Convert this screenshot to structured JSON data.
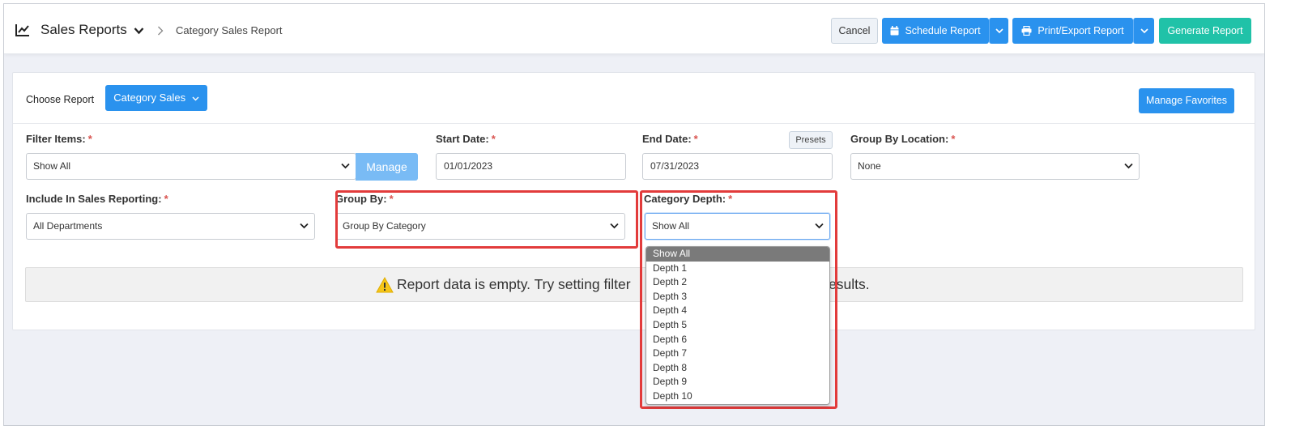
{
  "header": {
    "app_title": "Sales Reports",
    "breadcrumb": "Category Sales Report",
    "cancel_label": "Cancel",
    "schedule_label": "Schedule Report",
    "print_label": "Print/Export Report",
    "generate_label": "Generate Report"
  },
  "report_chooser": {
    "label": "Choose Report",
    "selected": "Category Sales",
    "favorites_label": "Manage Favorites"
  },
  "filters": {
    "filter_items": {
      "label": "Filter Items:",
      "value": "Show All",
      "manage_label": "Manage"
    },
    "start_date": {
      "label": "Start Date:",
      "value": "01/01/2023"
    },
    "end_date": {
      "label": "End Date:",
      "value": "07/31/2023",
      "presets_label": "Presets"
    },
    "group_by_location": {
      "label": "Group By Location:",
      "value": "None"
    },
    "include_in_sales": {
      "label": "Include In Sales Reporting:",
      "value": "All Departments"
    },
    "group_by": {
      "label": "Group By:",
      "value": "Group By Category"
    },
    "category_depth": {
      "label": "Category Depth:",
      "value": "Show All",
      "options": [
        "Show All",
        "Depth 1",
        "Depth 2",
        "Depth 3",
        "Depth 4",
        "Depth 5",
        "Depth 6",
        "Depth 7",
        "Depth 8",
        "Depth 9",
        "Depth 10"
      ]
    },
    "required_mark": "*"
  },
  "empty_message": {
    "part1": "Report data is empty. Try setting filter",
    "part2": "r results."
  },
  "colors": {
    "primary": "#2a92ee",
    "success": "#20c2a8",
    "highlight": "#e23b3b",
    "required": "#d9534f"
  }
}
